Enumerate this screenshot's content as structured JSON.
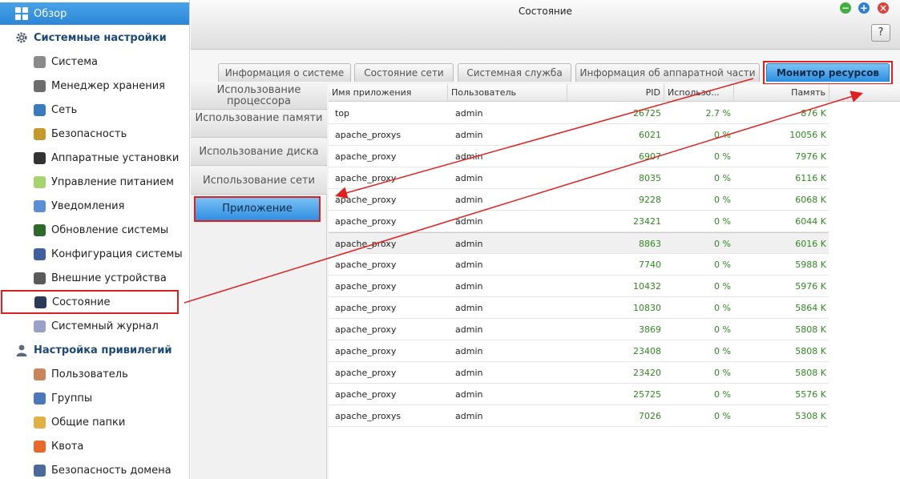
{
  "sidebar": {
    "overview": "Обзор",
    "system_group": "Системные настройки",
    "system_items": [
      {
        "label": "Система",
        "icon": "system-icon",
        "color": "#8a8a8a"
      },
      {
        "label": "Менеджер хранения",
        "icon": "storage-icon",
        "color": "#6d6d6d"
      },
      {
        "label": "Сеть",
        "icon": "network-icon",
        "color": "#3a7bbf"
      },
      {
        "label": "Безопасность",
        "icon": "lock-icon",
        "color": "#c59a2a"
      },
      {
        "label": "Аппаратные установки",
        "icon": "hardware-icon",
        "color": "#333333"
      },
      {
        "label": "Управление питанием",
        "icon": "bulb-icon",
        "color": "#a6d36b"
      },
      {
        "label": "Уведомления",
        "icon": "notification-icon",
        "color": "#5a8fd6"
      },
      {
        "label": "Обновление системы",
        "icon": "update-icon",
        "color": "#2d6b2d"
      },
      {
        "label": "Конфигурация системы",
        "icon": "config-icon",
        "color": "#3f5f9f"
      },
      {
        "label": "Внешние устройства",
        "icon": "external-device-icon",
        "color": "#5a5a5a"
      },
      {
        "label": "Состояние",
        "icon": "monitor-icon",
        "color": "#2a3b5a"
      },
      {
        "label": "Системный журнал",
        "icon": "log-icon",
        "color": "#9aa0c8"
      }
    ],
    "privileges_group": "Настройка привилегий",
    "privilege_items": [
      {
        "label": "Пользователь",
        "icon": "user-icon",
        "color": "#c8865a"
      },
      {
        "label": "Группы",
        "icon": "groups-icon",
        "color": "#4a78b8"
      },
      {
        "label": "Общие папки",
        "icon": "folder-icon",
        "color": "#e0b040"
      },
      {
        "label": "Квота",
        "icon": "quota-icon",
        "color": "#e86a2a"
      },
      {
        "label": "Безопасность домена",
        "icon": "domain-security-icon",
        "color": "#4a6a9a"
      }
    ]
  },
  "window": {
    "title": "Состояние",
    "help": "?",
    "tabs": [
      "Информация о системе",
      "Состояние сети",
      "Системная служба",
      "Информация об аппаратной части",
      "Монитор ресурсов"
    ],
    "subnav": [
      "Использование процессора",
      "Использование памяти",
      "Использование диска",
      "Использование сети",
      "Приложение"
    ]
  },
  "table": {
    "headers": [
      "Имя приложения",
      "Пользователь",
      "PID",
      "Использо...",
      "Память"
    ],
    "rows": [
      [
        "top",
        "admin",
        "26725",
        "2.7 %",
        "876 K"
      ],
      [
        "apache_proxys",
        "admin",
        "6021",
        "0 %",
        "10056 K"
      ],
      [
        "apache_proxy",
        "admin",
        "6907",
        "0 %",
        "7976 K"
      ],
      [
        "apache_proxy",
        "admin",
        "8035",
        "0 %",
        "6116 K"
      ],
      [
        "apache_proxy",
        "admin",
        "9228",
        "0 %",
        "6068 K"
      ],
      [
        "apache_proxy",
        "admin",
        "23421",
        "0 %",
        "6044 K"
      ],
      [
        "apache_proxy",
        "admin",
        "8863",
        "0 %",
        "6016 K"
      ],
      [
        "apache_proxy",
        "admin",
        "7740",
        "0 %",
        "5988 K"
      ],
      [
        "apache_proxy",
        "admin",
        "10432",
        "0 %",
        "5976 K"
      ],
      [
        "apache_proxy",
        "admin",
        "10830",
        "0 %",
        "5864 K"
      ],
      [
        "apache_proxy",
        "admin",
        "3869",
        "0 %",
        "5808 K"
      ],
      [
        "apache_proxy",
        "admin",
        "23408",
        "0 %",
        "5808 K"
      ],
      [
        "apache_proxy",
        "admin",
        "23420",
        "0 %",
        "5808 K"
      ],
      [
        "apache_proxy",
        "admin",
        "25725",
        "0 %",
        "5576 K"
      ],
      [
        "apache_proxys",
        "admin",
        "7026",
        "0 %",
        "5308 K"
      ]
    ]
  },
  "colors": {
    "accent": "#2d86d6",
    "annotation": "#e02020",
    "numbers": "#2f8a20"
  }
}
